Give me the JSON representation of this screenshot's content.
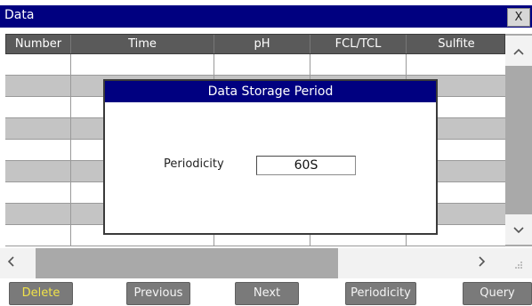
{
  "window": {
    "title": "Data",
    "close_label": "X"
  },
  "table": {
    "columns": [
      "Number",
      "Time",
      "pH",
      "FCL/TCL",
      "Sulfite"
    ],
    "rows": [
      [
        "",
        "",
        "",
        "",
        ""
      ],
      [
        "",
        "",
        "",
        "",
        ""
      ],
      [
        "",
        "",
        "",
        "",
        ""
      ],
      [
        "",
        "",
        "",
        "",
        ""
      ],
      [
        "",
        "",
        "",
        "",
        ""
      ],
      [
        "",
        "",
        "",
        "",
        ""
      ],
      [
        "",
        "",
        "",
        "",
        ""
      ],
      [
        "",
        "",
        "",
        "",
        ""
      ],
      [
        "",
        "",
        "",
        "",
        ""
      ]
    ]
  },
  "scrollbars": {
    "up_glyph": "^",
    "down_glyph": "v",
    "left_glyph": "<",
    "right_glyph": ">",
    "grip_glyph": ".:"
  },
  "dialog": {
    "title": "Data Storage Period",
    "periodicity_label": "Periodicity",
    "periodicity_value": "60S"
  },
  "buttons": {
    "delete": "Delete",
    "previous": "Previous",
    "next": "Next",
    "periodicity": "Periodicity",
    "query": "Query"
  },
  "colors": {
    "title_bar": "#000080",
    "header_bg": "#5a5a5a",
    "row_grey": "#c4c4c4",
    "button_bg": "#7a7a7a",
    "delete_text": "#f0e24a"
  }
}
